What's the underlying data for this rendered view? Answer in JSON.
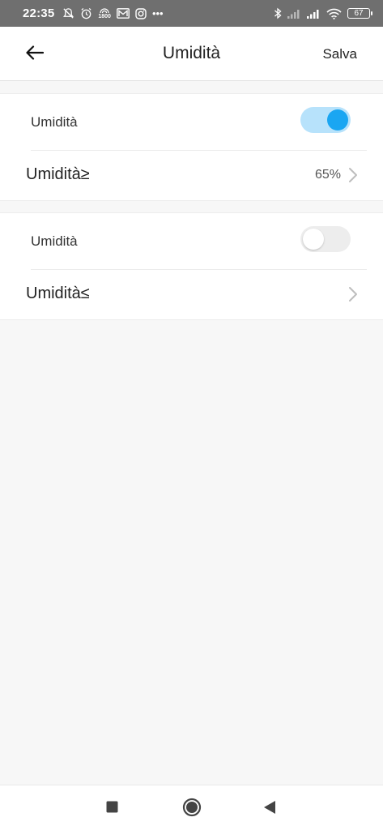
{
  "status_bar": {
    "time": "22:35",
    "network_badge": "1800",
    "more_indicator": "•••",
    "battery": "67",
    "left_icons": [
      "muted-bell-icon",
      "alarm-icon",
      "hotspot-icon",
      "mail-icon",
      "instagram-icon"
    ],
    "right_icons": [
      "bluetooth-icon",
      "signal-icon",
      "signal-icon",
      "wifi-icon",
      "battery-icon"
    ]
  },
  "app_bar": {
    "title": "Umidità",
    "save_label": "Salva",
    "back_icon": "arrow-left-icon"
  },
  "sections": [
    {
      "toggle_label": "Umidità",
      "toggle_on": true,
      "nav_label": "Umidità≥",
      "nav_value": "65%"
    },
    {
      "toggle_label": "Umidità",
      "toggle_on": false,
      "nav_label": "Umidità≤",
      "nav_value": ""
    }
  ],
  "colors": {
    "accent": "#1aa6f2",
    "toggle_track_on": "#b7e2fb",
    "status_bar": "#6f6f6f",
    "background": "#f7f7f7"
  },
  "nav_bar": {
    "icons": [
      "recents-square-icon",
      "home-circle-icon",
      "back-triangle-icon"
    ]
  }
}
